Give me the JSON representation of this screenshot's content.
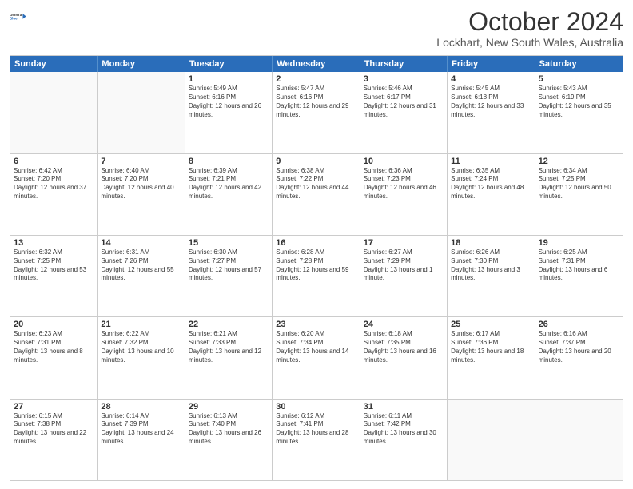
{
  "header": {
    "logo_line1": "General",
    "logo_line2": "Blue",
    "title": "October 2024",
    "subtitle": "Lockhart, New South Wales, Australia"
  },
  "days": [
    "Sunday",
    "Monday",
    "Tuesday",
    "Wednesday",
    "Thursday",
    "Friday",
    "Saturday"
  ],
  "rows": [
    [
      {
        "day": "",
        "empty": true
      },
      {
        "day": "",
        "empty": true
      },
      {
        "day": "1",
        "sunrise": "Sunrise: 5:49 AM",
        "sunset": "Sunset: 6:16 PM",
        "daylight": "Daylight: 12 hours and 26 minutes."
      },
      {
        "day": "2",
        "sunrise": "Sunrise: 5:47 AM",
        "sunset": "Sunset: 6:16 PM",
        "daylight": "Daylight: 12 hours and 29 minutes."
      },
      {
        "day": "3",
        "sunrise": "Sunrise: 5:46 AM",
        "sunset": "Sunset: 6:17 PM",
        "daylight": "Daylight: 12 hours and 31 minutes."
      },
      {
        "day": "4",
        "sunrise": "Sunrise: 5:45 AM",
        "sunset": "Sunset: 6:18 PM",
        "daylight": "Daylight: 12 hours and 33 minutes."
      },
      {
        "day": "5",
        "sunrise": "Sunrise: 5:43 AM",
        "sunset": "Sunset: 6:19 PM",
        "daylight": "Daylight: 12 hours and 35 minutes."
      }
    ],
    [
      {
        "day": "6",
        "sunrise": "Sunrise: 6:42 AM",
        "sunset": "Sunset: 7:20 PM",
        "daylight": "Daylight: 12 hours and 37 minutes."
      },
      {
        "day": "7",
        "sunrise": "Sunrise: 6:40 AM",
        "sunset": "Sunset: 7:20 PM",
        "daylight": "Daylight: 12 hours and 40 minutes."
      },
      {
        "day": "8",
        "sunrise": "Sunrise: 6:39 AM",
        "sunset": "Sunset: 7:21 PM",
        "daylight": "Daylight: 12 hours and 42 minutes."
      },
      {
        "day": "9",
        "sunrise": "Sunrise: 6:38 AM",
        "sunset": "Sunset: 7:22 PM",
        "daylight": "Daylight: 12 hours and 44 minutes."
      },
      {
        "day": "10",
        "sunrise": "Sunrise: 6:36 AM",
        "sunset": "Sunset: 7:23 PM",
        "daylight": "Daylight: 12 hours and 46 minutes."
      },
      {
        "day": "11",
        "sunrise": "Sunrise: 6:35 AM",
        "sunset": "Sunset: 7:24 PM",
        "daylight": "Daylight: 12 hours and 48 minutes."
      },
      {
        "day": "12",
        "sunrise": "Sunrise: 6:34 AM",
        "sunset": "Sunset: 7:25 PM",
        "daylight": "Daylight: 12 hours and 50 minutes."
      }
    ],
    [
      {
        "day": "13",
        "sunrise": "Sunrise: 6:32 AM",
        "sunset": "Sunset: 7:25 PM",
        "daylight": "Daylight: 12 hours and 53 minutes."
      },
      {
        "day": "14",
        "sunrise": "Sunrise: 6:31 AM",
        "sunset": "Sunset: 7:26 PM",
        "daylight": "Daylight: 12 hours and 55 minutes."
      },
      {
        "day": "15",
        "sunrise": "Sunrise: 6:30 AM",
        "sunset": "Sunset: 7:27 PM",
        "daylight": "Daylight: 12 hours and 57 minutes."
      },
      {
        "day": "16",
        "sunrise": "Sunrise: 6:28 AM",
        "sunset": "Sunset: 7:28 PM",
        "daylight": "Daylight: 12 hours and 59 minutes."
      },
      {
        "day": "17",
        "sunrise": "Sunrise: 6:27 AM",
        "sunset": "Sunset: 7:29 PM",
        "daylight": "Daylight: 13 hours and 1 minute."
      },
      {
        "day": "18",
        "sunrise": "Sunrise: 6:26 AM",
        "sunset": "Sunset: 7:30 PM",
        "daylight": "Daylight: 13 hours and 3 minutes."
      },
      {
        "day": "19",
        "sunrise": "Sunrise: 6:25 AM",
        "sunset": "Sunset: 7:31 PM",
        "daylight": "Daylight: 13 hours and 6 minutes."
      }
    ],
    [
      {
        "day": "20",
        "sunrise": "Sunrise: 6:23 AM",
        "sunset": "Sunset: 7:31 PM",
        "daylight": "Daylight: 13 hours and 8 minutes."
      },
      {
        "day": "21",
        "sunrise": "Sunrise: 6:22 AM",
        "sunset": "Sunset: 7:32 PM",
        "daylight": "Daylight: 13 hours and 10 minutes."
      },
      {
        "day": "22",
        "sunrise": "Sunrise: 6:21 AM",
        "sunset": "Sunset: 7:33 PM",
        "daylight": "Daylight: 13 hours and 12 minutes."
      },
      {
        "day": "23",
        "sunrise": "Sunrise: 6:20 AM",
        "sunset": "Sunset: 7:34 PM",
        "daylight": "Daylight: 13 hours and 14 minutes."
      },
      {
        "day": "24",
        "sunrise": "Sunrise: 6:18 AM",
        "sunset": "Sunset: 7:35 PM",
        "daylight": "Daylight: 13 hours and 16 minutes."
      },
      {
        "day": "25",
        "sunrise": "Sunrise: 6:17 AM",
        "sunset": "Sunset: 7:36 PM",
        "daylight": "Daylight: 13 hours and 18 minutes."
      },
      {
        "day": "26",
        "sunrise": "Sunrise: 6:16 AM",
        "sunset": "Sunset: 7:37 PM",
        "daylight": "Daylight: 13 hours and 20 minutes."
      }
    ],
    [
      {
        "day": "27",
        "sunrise": "Sunrise: 6:15 AM",
        "sunset": "Sunset: 7:38 PM",
        "daylight": "Daylight: 13 hours and 22 minutes."
      },
      {
        "day": "28",
        "sunrise": "Sunrise: 6:14 AM",
        "sunset": "Sunset: 7:39 PM",
        "daylight": "Daylight: 13 hours and 24 minutes."
      },
      {
        "day": "29",
        "sunrise": "Sunrise: 6:13 AM",
        "sunset": "Sunset: 7:40 PM",
        "daylight": "Daylight: 13 hours and 26 minutes."
      },
      {
        "day": "30",
        "sunrise": "Sunrise: 6:12 AM",
        "sunset": "Sunset: 7:41 PM",
        "daylight": "Daylight: 13 hours and 28 minutes."
      },
      {
        "day": "31",
        "sunrise": "Sunrise: 6:11 AM",
        "sunset": "Sunset: 7:42 PM",
        "daylight": "Daylight: 13 hours and 30 minutes."
      },
      {
        "day": "",
        "empty": true
      },
      {
        "day": "",
        "empty": true
      }
    ]
  ]
}
